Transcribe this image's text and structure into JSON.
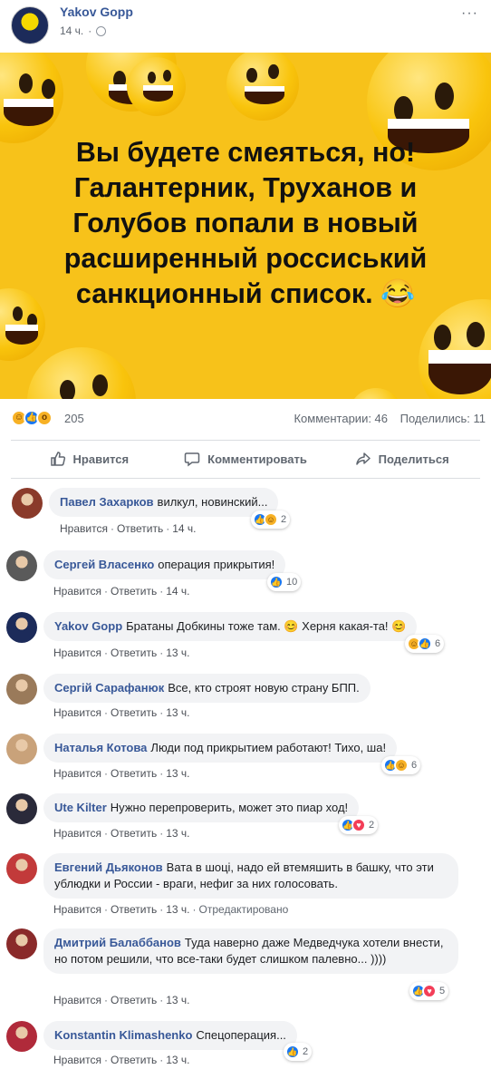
{
  "post": {
    "author": "Yakov Gopp",
    "time": "14 ч.",
    "more": "···",
    "text_lines": [
      "Вы будете смеяться, но!",
      "Галантерник, Труханов и",
      "Голубов попали в новый",
      "расширенный россиський",
      "санкционный список."
    ],
    "text_emoji": "😂"
  },
  "reactions": {
    "count": "205",
    "comments": "Комментарии: 46",
    "shares": "Поделились: 11"
  },
  "actions": {
    "like": "Нравится",
    "comment": "Комментировать",
    "share": "Поделиться"
  },
  "comment_actions": {
    "like": "Нравится",
    "reply": "Ответить"
  },
  "comments": [
    {
      "author": "Павел Захарков",
      "text": "вилкул, новинский...",
      "time": "14 ч.",
      "reactions": [
        "like",
        "haha"
      ],
      "count": "2",
      "avatar_color": "#8a3a2a"
    },
    {
      "author": "Сергей Власенко",
      "text": "операция прикрытия!",
      "time": "14 ч.",
      "reactions": [
        "like"
      ],
      "count": "10",
      "avatar_color": "#5a5a5a"
    },
    {
      "author": "Yakov Gopp",
      "text": "Братаны Добкины тоже там. 😊 Херня какая-та! 😊",
      "time": "13 ч.",
      "reactions": [
        "haha",
        "like"
      ],
      "count": "6",
      "avatar_color": "#1c2b5a"
    },
    {
      "author": "Сергій Сарафанюк",
      "text": "Все, кто строят новую страну БПП.",
      "time": "13 ч.",
      "reactions": [],
      "count": "",
      "avatar_color": "#9a7a5a"
    },
    {
      "author": "Наталья Котова",
      "text": "Люди под прикрытием работают! Тихо, ша!",
      "time": "13 ч.",
      "reactions": [
        "like",
        "haha"
      ],
      "count": "6",
      "avatar_color": "#c9a27a"
    },
    {
      "author": "Ute Kilter",
      "text": "Нужно перепроверить, может это пиар ход!",
      "time": "13 ч.",
      "reactions": [
        "like",
        "love"
      ],
      "count": "2",
      "avatar_color": "#2a2a3a"
    },
    {
      "author": "Евгений Дьяконов",
      "text": "Вата в шоці, надо ей втемяшить в башку, что эти ублюдки и России - враги, нефиг за них голосовать.",
      "time": "13 ч.",
      "edited": "Отредактировано",
      "reactions": [],
      "count": "",
      "avatar_color": "#c23a3a"
    },
    {
      "author": "Дмитрий Балаббанов",
      "text": "Туда наверно даже Медведчука хотели внести, но потом решили, что все-таки будет слишком палевно... ))))",
      "time": "13 ч.",
      "reactions": [
        "like",
        "love"
      ],
      "count": "5",
      "avatar_color": "#8a2a2a"
    },
    {
      "author": "Konstantin Klimashenko",
      "text": "Спецоперация...",
      "time": "13 ч.",
      "reactions": [
        "like"
      ],
      "count": "2",
      "avatar_color": "#b02a3a"
    }
  ],
  "colors": {
    "link": "#385898",
    "muted": "#606770",
    "bubble": "#f2f3f5",
    "like": "#1877f2",
    "love": "#f33e58",
    "haha": "#f7b125",
    "image_bg": "#f7c21a"
  }
}
